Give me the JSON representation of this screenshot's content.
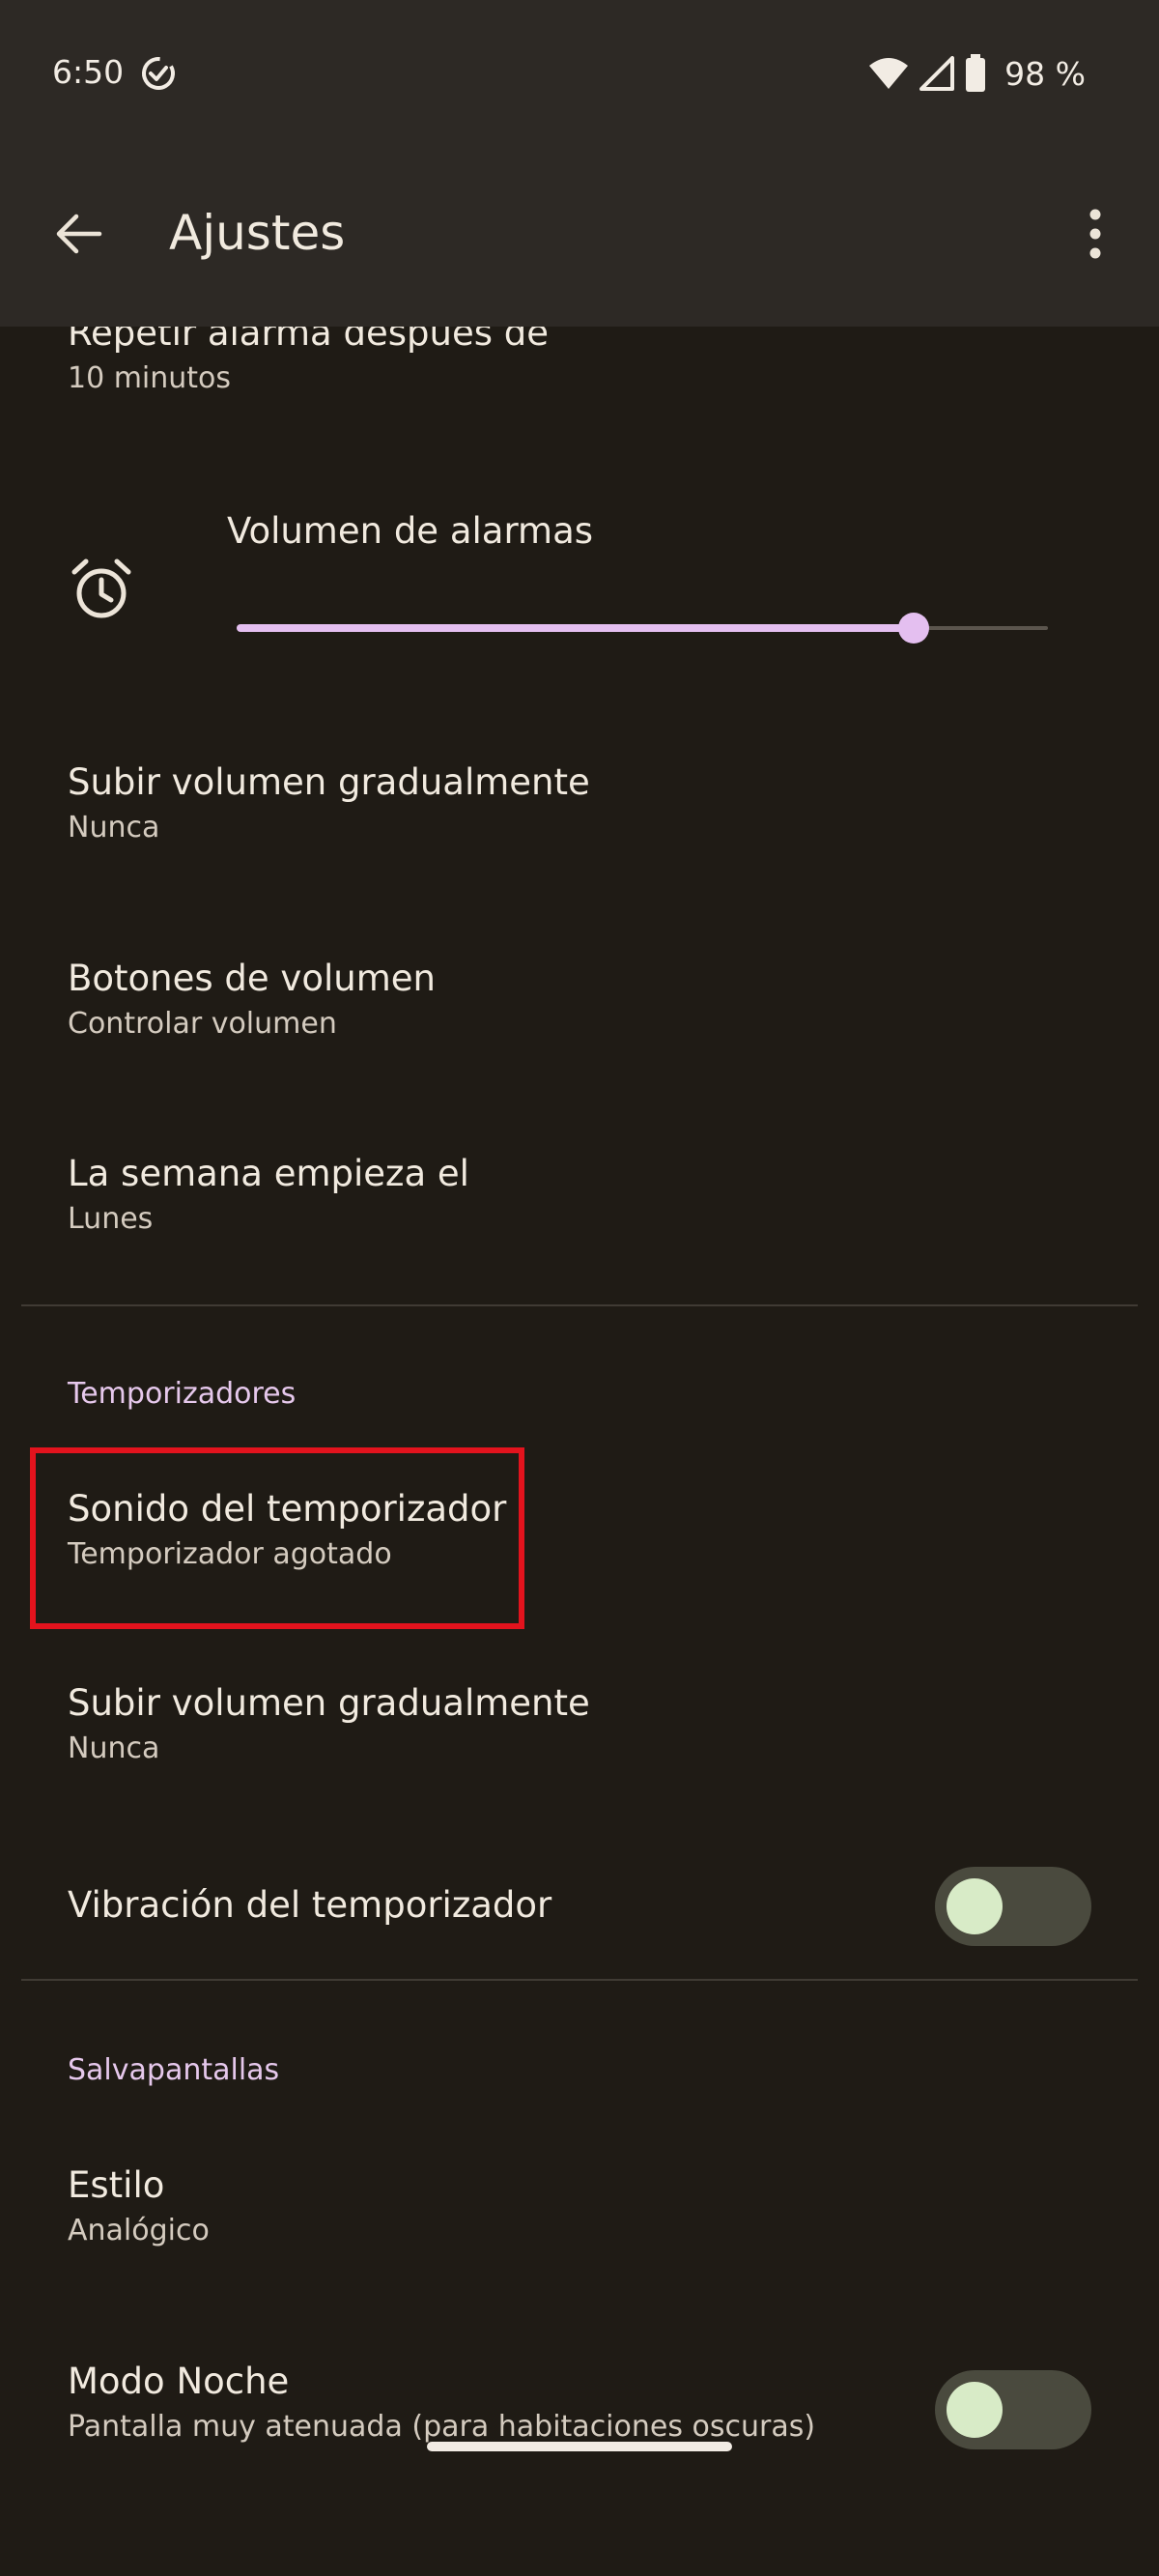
{
  "status_bar": {
    "time": "6:50",
    "battery": "98 %",
    "icons": [
      "check-circle-icon",
      "wifi-icon",
      "signal-icon",
      "battery-icon"
    ]
  },
  "toolbar": {
    "title": "Ajustes",
    "back_icon": "arrow-left-icon",
    "menu_icon": "more-vertical-icon"
  },
  "alarms": {
    "snooze_title": "Repetir alarma después de",
    "snooze_value": "10 minutos",
    "volume_label": "Volumen de alarmas",
    "volume_level": 0.835,
    "gradual_title": "Subir volumen gradualmente",
    "gradual_value": "Nunca",
    "buttons_title": "Botones de volumen",
    "buttons_value": "Controlar volumen",
    "week_title": "La semana empieza el",
    "week_value": "Lunes"
  },
  "timers": {
    "section_title": "Temporizadores",
    "sound_title": "Sonido del temporizador",
    "sound_value": "Temporizador agotado",
    "gradual_title": "Subir volumen gradualmente",
    "gradual_value": "Nunca",
    "vibration_title": "Vibración del temporizador",
    "vibration_enabled": false
  },
  "screensaver": {
    "section_title": "Salvapantallas",
    "style_title": "Estilo",
    "style_value": "Analógico",
    "night_title": "Modo Noche",
    "night_value": "Pantalla muy atenuada (para habitaciones oscuras)",
    "night_enabled": false
  },
  "colors": {
    "background": "#1f1b15",
    "toolbar": "#2d2925",
    "accent": "#e4bff0",
    "highlight": "#e3131d",
    "toggle_track": "#4a4a3e",
    "toggle_knob": "#d8ebc7"
  }
}
